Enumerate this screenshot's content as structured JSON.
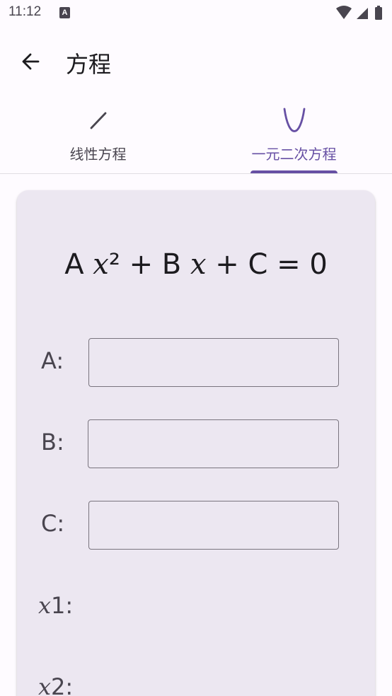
{
  "status_bar": {
    "time": "11:12",
    "notification_letter": "A",
    "icons": [
      "wifi-icon",
      "signal-icon",
      "battery-icon"
    ]
  },
  "app_bar": {
    "title": "方程",
    "back_icon": "arrow-back-icon"
  },
  "tabs": [
    {
      "label": "线性方程",
      "icon": "line-icon",
      "selected": false
    },
    {
      "label": "一元二次方程",
      "icon": "parabola-icon",
      "selected": true
    }
  ],
  "card": {
    "equation": {
      "a": "A ",
      "x1": "x",
      "sq": "² + B ",
      "x2": "x",
      "rest": " + C = 0"
    },
    "fields": [
      {
        "label": "A:",
        "value": ""
      },
      {
        "label": "B:",
        "value": ""
      },
      {
        "label": "C:",
        "value": ""
      }
    ],
    "results": [
      {
        "var": "x",
        "label": "1:"
      },
      {
        "var": "x",
        "label": "2:"
      }
    ]
  },
  "colors": {
    "accent": "#6750a4",
    "card_bg": "#ece7f1",
    "page_bg": "#fefbff",
    "outline": "#79747e"
  }
}
